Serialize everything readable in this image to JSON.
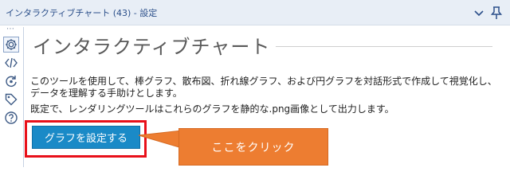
{
  "window": {
    "title": "インタラクティブチャート (43) - 設定"
  },
  "sidebar": {
    "items": [
      {
        "icon": "gear-icon",
        "active": true
      },
      {
        "icon": "code-icon"
      },
      {
        "icon": "refresh-target-icon"
      },
      {
        "icon": "tag-icon"
      },
      {
        "icon": "help-icon"
      }
    ],
    "overflow_dots": "⋯"
  },
  "main": {
    "heading": "インタラクティブチャート",
    "description": "このツールを使用して、棒グラフ、散布図、折れ線グラフ、および円グラフを対話形式で作成して視覚化し、データを理解する手助けとします。",
    "default_note": "既定で、レンダリングツールはこれらのグラフを静的な.png画像として出力します。",
    "configure_button_label": "グラフを設定する"
  },
  "annotation": {
    "callout_text": "ここをクリック",
    "highlight_color": "#e8101a",
    "callout_color": "#ed7d31"
  },
  "colors": {
    "button_bg": "#1a8ac7",
    "title_text": "#2b4f8a"
  }
}
